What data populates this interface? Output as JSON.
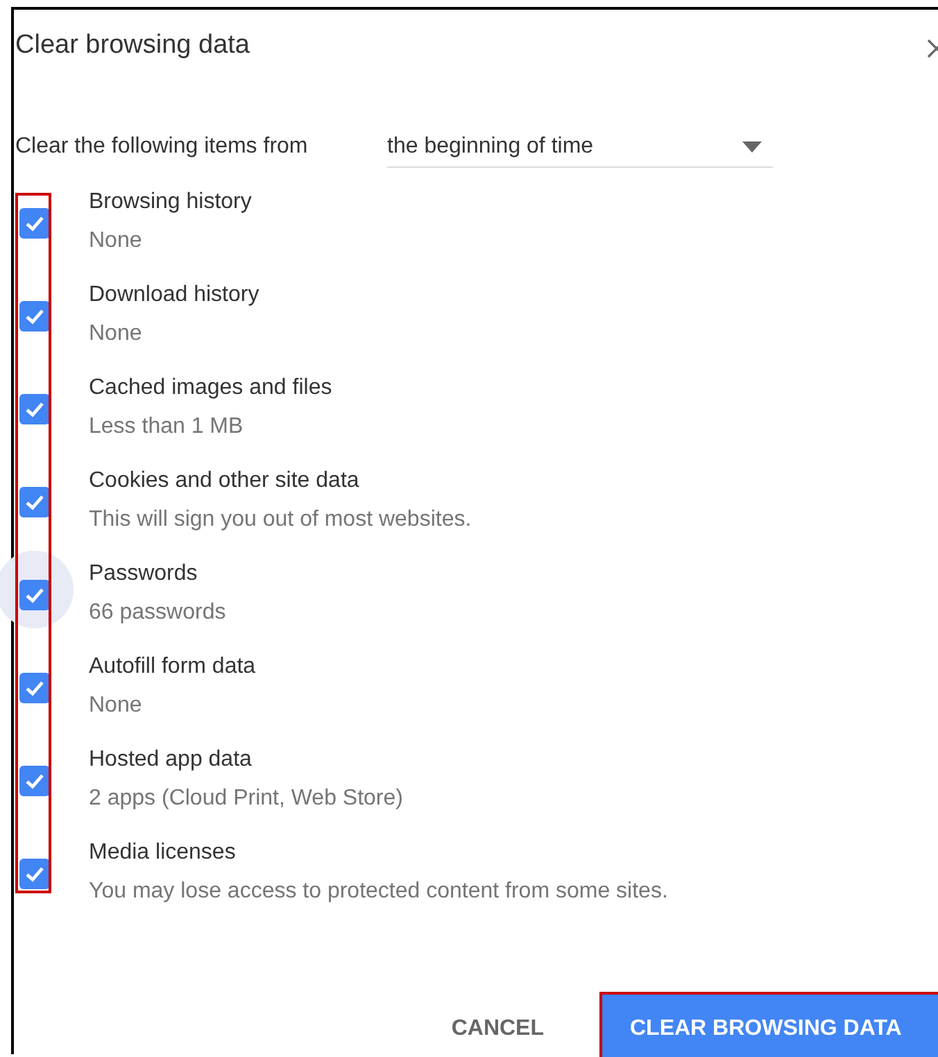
{
  "dialog": {
    "title": "Clear browsing data"
  },
  "time_range": {
    "label": "Clear the following items from",
    "value": "the beginning of time"
  },
  "checkbox_column_highlighted": true,
  "items": [
    {
      "label": "Browsing history",
      "detail": "None",
      "checked": true,
      "focused": false
    },
    {
      "label": "Download history",
      "detail": "None",
      "checked": true,
      "focused": false
    },
    {
      "label": "Cached images and files",
      "detail": "Less than 1 MB",
      "checked": true,
      "focused": false
    },
    {
      "label": "Cookies and other site data",
      "detail": "This will sign you out of most websites.",
      "checked": true,
      "focused": false
    },
    {
      "label": "Passwords",
      "detail": "66 passwords",
      "checked": true,
      "focused": true
    },
    {
      "label": "Autofill form data",
      "detail": "None",
      "checked": true,
      "focused": false
    },
    {
      "label": "Hosted app data",
      "detail": "2 apps (Cloud Print, Web Store)",
      "checked": true,
      "focused": false
    },
    {
      "label": "Media licenses",
      "detail": "You may lose access to protected content from some sites.",
      "checked": true,
      "focused": false
    }
  ],
  "buttons": [
    {
      "label": "CANCEL",
      "kind": "text",
      "highlighted": false
    },
    {
      "label": "CLEAR BROWSING DATA",
      "kind": "primary",
      "highlighted": true
    }
  ]
}
